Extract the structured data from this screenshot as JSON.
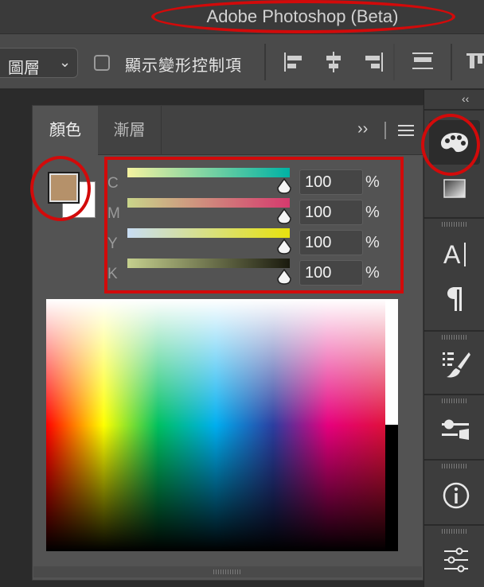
{
  "window": {
    "title": "Adobe Photoshop (Beta)"
  },
  "options_bar": {
    "layer_select": "圖層",
    "show_transform_label": "顯示變形控制項",
    "show_transform_checked": false
  },
  "color_panel": {
    "tabs": [
      {
        "label": "顏色",
        "active": true
      },
      {
        "label": "漸層",
        "active": false
      }
    ],
    "foreground_color": "#b5916a",
    "background_color": "#ffffff",
    "channels": [
      {
        "label": "C",
        "value": "100",
        "unit": "%",
        "track_from": "#f4f2a0",
        "track_to": "#00b2a4"
      },
      {
        "label": "M",
        "value": "100",
        "unit": "%",
        "track_from": "#c9d58a",
        "track_to": "#d63a6e"
      },
      {
        "label": "Y",
        "value": "100",
        "unit": "%",
        "track_from": "#c8ddf4",
        "track_to": "#e8e20e"
      },
      {
        "label": "K",
        "value": "100",
        "unit": "%",
        "track_from": "#c5d08e",
        "track_to": "#1a1a0e"
      }
    ]
  },
  "right_dock": {
    "collapse_glyph": "‹‹",
    "tools": [
      "color-palette-icon",
      "gradient-icon",
      "character-icon",
      "paragraph-icon",
      "brush-settings-icon",
      "properties-sliders-icon",
      "info-icon",
      "adjustments-icon"
    ]
  },
  "annotation_color": "#d20a0a"
}
